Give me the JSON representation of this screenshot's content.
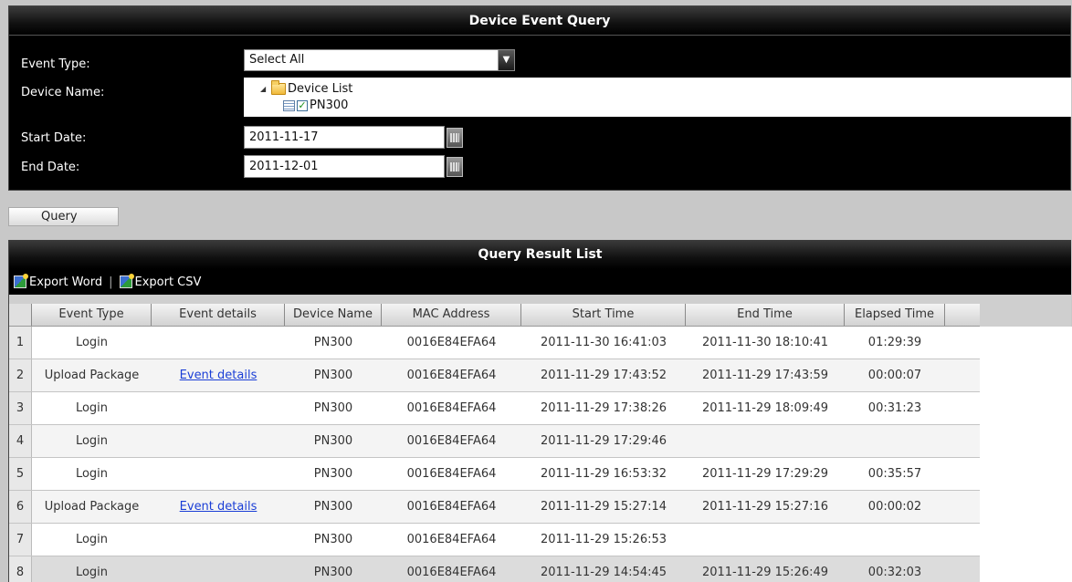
{
  "query_panel": {
    "title": "Device Event Query",
    "event_type_label": "Event Type:",
    "event_type_value": "Select All",
    "device_name_label": "Device Name:",
    "tree": {
      "root_label": "Device List",
      "children": [
        {
          "label": "PN300",
          "checked": true
        }
      ]
    },
    "start_date_label": "Start Date:",
    "start_date_value": "2011-11-17",
    "end_date_label": "End Date:",
    "end_date_value": "2011-12-01"
  },
  "query_button_label": "Query",
  "results": {
    "title": "Query Result List",
    "export_word_label": "Export Word",
    "export_csv_label": "Export CSV",
    "separator": "|",
    "columns": [
      "Event Type",
      "Event details",
      "Device Name",
      "MAC Address",
      "Start Time",
      "End Time",
      "Elapsed Time"
    ],
    "rows": [
      {
        "num": "1",
        "event_type": "Login",
        "event_details": "",
        "device_name": "PN300",
        "mac": "0016E84EFA64",
        "start": "2011-11-30 16:41:03",
        "end": "2011-11-30 18:10:41",
        "elapsed": "01:29:39"
      },
      {
        "num": "2",
        "event_type": "Upload Package",
        "event_details": "Event details",
        "device_name": "PN300",
        "mac": "0016E84EFA64",
        "start": "2011-11-29 17:43:52",
        "end": "2011-11-29 17:43:59",
        "elapsed": "00:00:07"
      },
      {
        "num": "3",
        "event_type": "Login",
        "event_details": "",
        "device_name": "PN300",
        "mac": "0016E84EFA64",
        "start": "2011-11-29 17:38:26",
        "end": "2011-11-29 18:09:49",
        "elapsed": "00:31:23"
      },
      {
        "num": "4",
        "event_type": "Login",
        "event_details": "",
        "device_name": "PN300",
        "mac": "0016E84EFA64",
        "start": "2011-11-29 17:29:46",
        "end": "",
        "elapsed": ""
      },
      {
        "num": "5",
        "event_type": "Login",
        "event_details": "",
        "device_name": "PN300",
        "mac": "0016E84EFA64",
        "start": "2011-11-29 16:53:32",
        "end": "2011-11-29 17:29:29",
        "elapsed": "00:35:57"
      },
      {
        "num": "6",
        "event_type": "Upload Package",
        "event_details": "Event details",
        "device_name": "PN300",
        "mac": "0016E84EFA64",
        "start": "2011-11-29 15:27:14",
        "end": "2011-11-29 15:27:16",
        "elapsed": "00:00:02"
      },
      {
        "num": "7",
        "event_type": "Login",
        "event_details": "",
        "device_name": "PN300",
        "mac": "0016E84EFA64",
        "start": "2011-11-29 15:26:53",
        "end": "",
        "elapsed": ""
      },
      {
        "num": "8",
        "event_type": "Login",
        "event_details": "",
        "device_name": "PN300",
        "mac": "0016E84EFA64",
        "start": "2011-11-29 14:54:45",
        "end": "2011-11-29 15:26:49",
        "elapsed": "00:32:03"
      }
    ],
    "selected_row": 8
  }
}
